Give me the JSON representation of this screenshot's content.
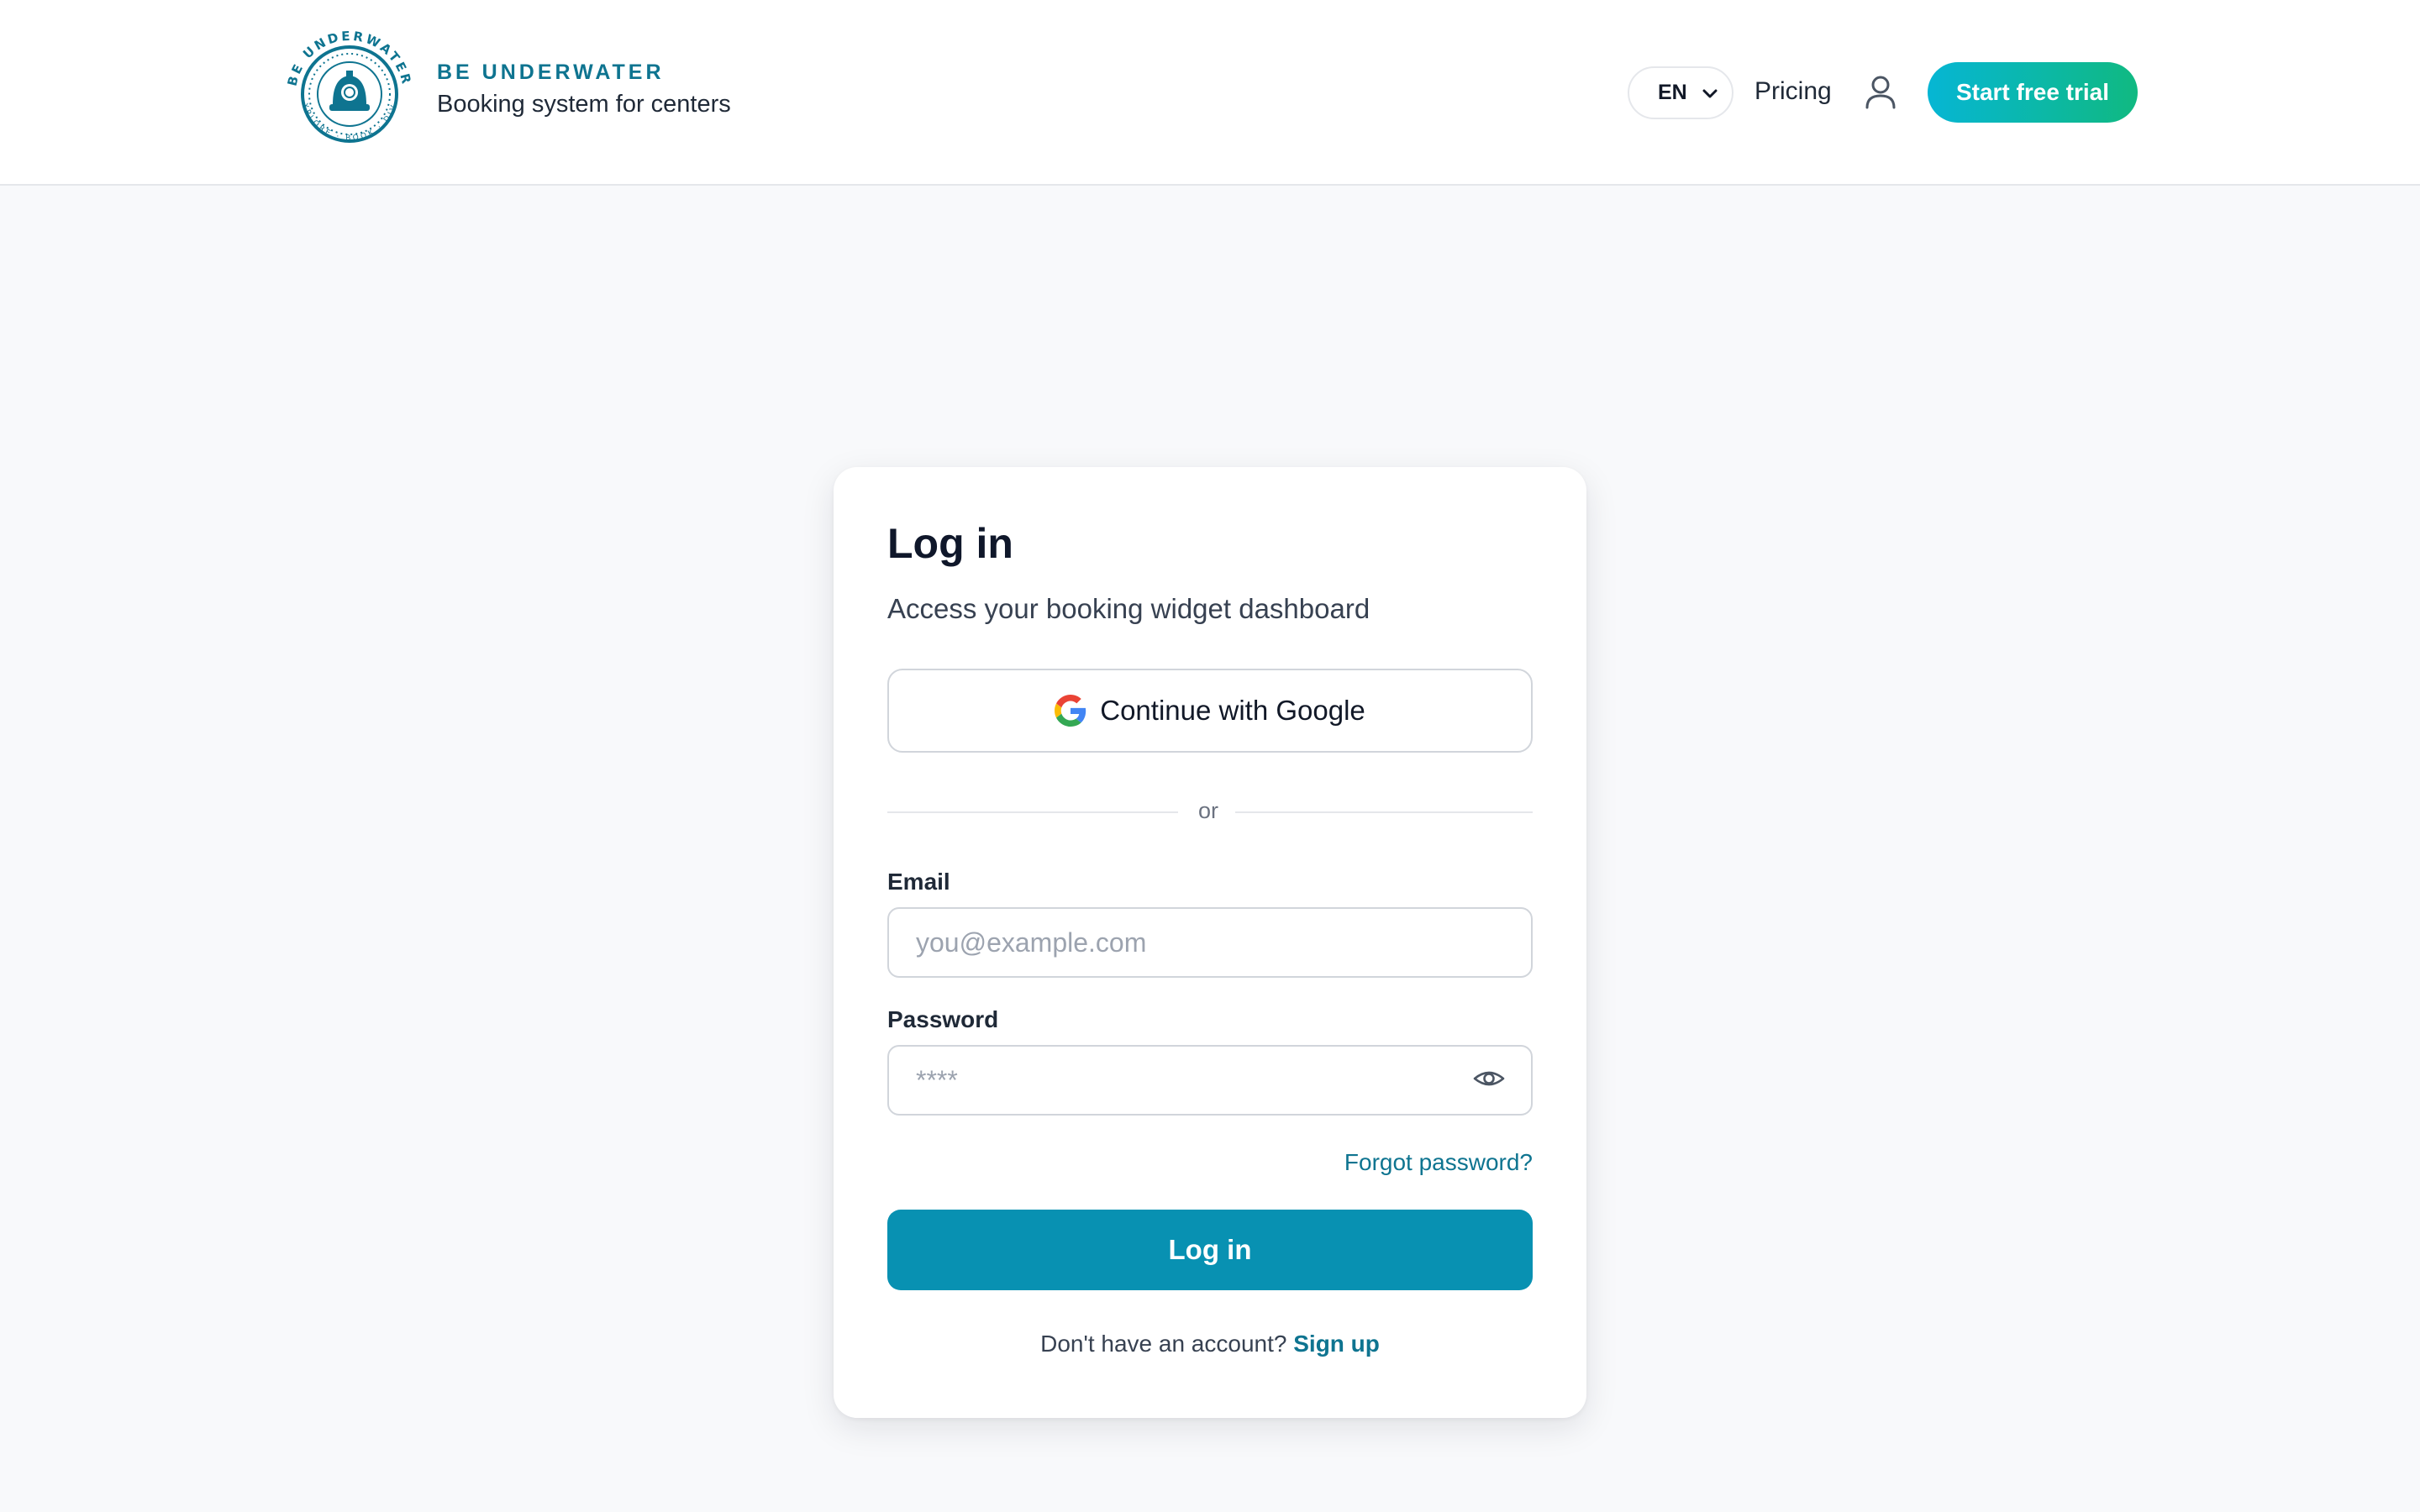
{
  "header": {
    "brand_name": "BE UNDERWATER",
    "brand_tagline": "Booking system for centers",
    "logo_ring_top": "BE UNDERWATER",
    "logo_ring_bottom": "EXPLORE · BOOK · DIVE",
    "language": {
      "selected": "EN",
      "icon": "chevron-down-icon"
    },
    "nav_pricing": "Pricing",
    "user_icon": "user-icon",
    "cta_label": "Start free trial"
  },
  "login": {
    "title": "Log in",
    "subtitle": "Access your booking widget dashboard",
    "google_label": "Continue with Google",
    "divider_text": "or",
    "email": {
      "label": "Email",
      "placeholder": "you@example.com",
      "value": ""
    },
    "password": {
      "label": "Password",
      "placeholder": "****",
      "value": "",
      "toggle_icon": "eye-icon"
    },
    "forgot_label": "Forgot password?",
    "submit_label": "Log in",
    "signup_prompt": "Don't have an account?",
    "signup_link": "Sign up"
  },
  "colors": {
    "brand": "#0e7490",
    "primary_button": "#0891b2",
    "cta_gradient_start": "#06b6d4",
    "cta_gradient_end": "#10b981",
    "page_background": "#f8f9fb"
  }
}
